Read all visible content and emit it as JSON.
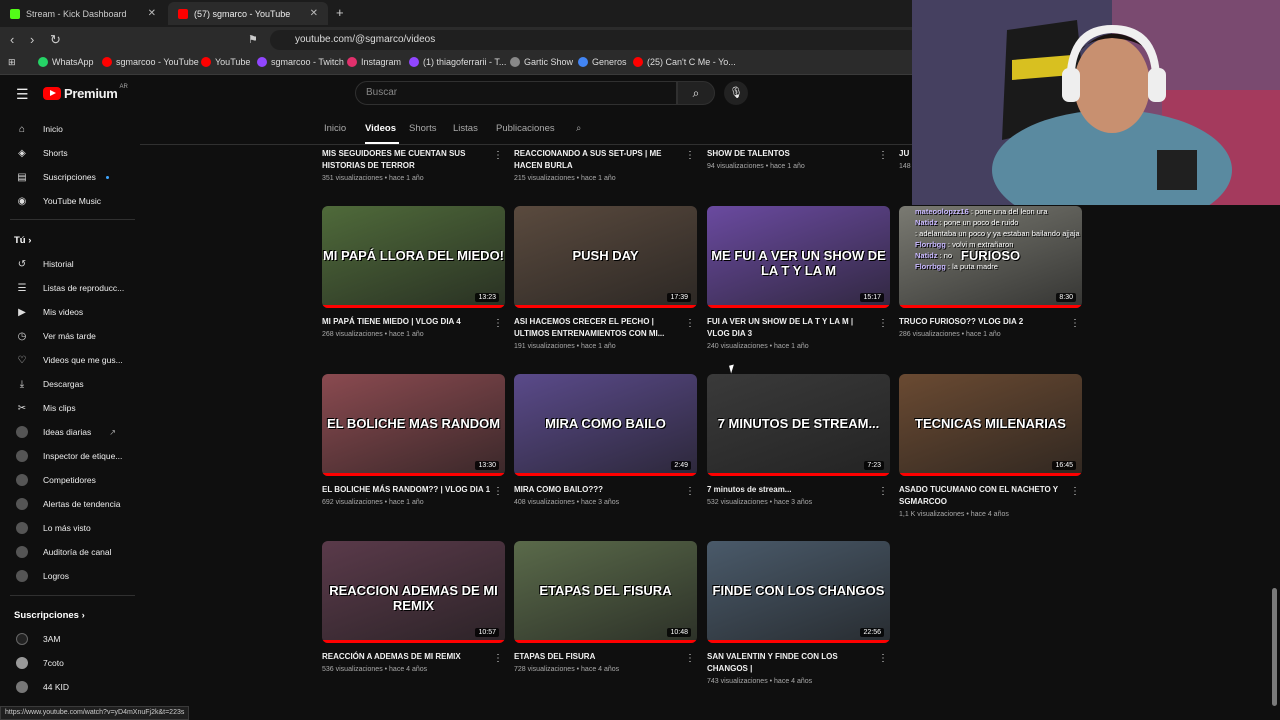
{
  "browser": {
    "tabs": [
      {
        "title": "Stream - Kick Dashboard",
        "fav_color": "#53fc18"
      },
      {
        "title": "(57) sgmarco - YouTube",
        "fav_color": "#ff0000"
      }
    ],
    "new_tab_icon": "+",
    "url": "youtube.com/@sgmarco/videos",
    "bookmarks": [
      {
        "label": "WhatsApp",
        "color": "#25d366"
      },
      {
        "label": "sgmarcoo - YouTube",
        "color": "#ff0000"
      },
      {
        "label": "YouTube",
        "color": "#ff0000"
      },
      {
        "label": "sgmarcoo - Twitch",
        "color": "#9146ff"
      },
      {
        "label": "Instagram",
        "color": "#e1306c"
      },
      {
        "label": "(1) thiagoferrarii - T...",
        "color": "#9146ff"
      },
      {
        "label": "Gartic Show",
        "color": "#888888"
      },
      {
        "label": "Generos",
        "color": "#4285f4"
      },
      {
        "label": "(25) Can't C Me - Yo...",
        "color": "#ff0000"
      }
    ],
    "status_url": "https://www.youtube.com/watch?v=yD4mXnuFj2k&t=223s"
  },
  "masthead": {
    "logo_text": "Premium",
    "country_code": "AR",
    "search_placeholder": "Buscar"
  },
  "sidebar": {
    "main": [
      {
        "label": "Inicio",
        "icon": "home-icon",
        "glyph": "⌂"
      },
      {
        "label": "Shorts",
        "icon": "shorts-icon",
        "glyph": "◈"
      },
      {
        "label": "Suscripciones",
        "icon": "subscriptions-icon",
        "glyph": "▤"
      },
      {
        "label": "YouTube Music",
        "icon": "music-icon",
        "glyph": "◉"
      }
    ],
    "you_title": "Tú",
    "you": [
      {
        "label": "Historial",
        "icon": "history-icon",
        "glyph": "↺"
      },
      {
        "label": "Listas de reproducc...",
        "icon": "playlists-icon",
        "glyph": "☰"
      },
      {
        "label": "Mis videos",
        "icon": "my-videos-icon",
        "glyph": "▶"
      },
      {
        "label": "Ver más tarde",
        "icon": "watch-later-icon",
        "glyph": "◷"
      },
      {
        "label": "Videos que me gus...",
        "icon": "liked-icon",
        "glyph": "👍"
      },
      {
        "label": "Descargas",
        "icon": "downloads-icon",
        "glyph": "⤓"
      },
      {
        "label": "Mis clips",
        "icon": "clips-icon",
        "glyph": "✂"
      },
      {
        "label": "Ideas diarias",
        "icon": "ideas-icon",
        "glyph": "●"
      },
      {
        "label": "Inspector de etique...",
        "icon": "tag-inspector-icon",
        "glyph": "●"
      },
      {
        "label": "Competidores",
        "icon": "competitors-icon",
        "glyph": "●"
      },
      {
        "label": "Alertas de tendencia",
        "icon": "trend-alerts-icon",
        "glyph": "●"
      },
      {
        "label": "Lo más visto",
        "icon": "most-viewed-icon",
        "glyph": "●"
      },
      {
        "label": "Auditoría de canal",
        "icon": "channel-audit-icon",
        "glyph": "●"
      },
      {
        "label": "Logros",
        "icon": "achievements-icon",
        "glyph": "●"
      }
    ],
    "subs_title": "Suscripciones",
    "subs": [
      {
        "label": "3AM"
      },
      {
        "label": "7coto"
      },
      {
        "label": "44 KID"
      }
    ]
  },
  "channel_tabs": [
    "Inicio",
    "Videos",
    "Shorts",
    "Listas",
    "Publicaciones"
  ],
  "top_row": [
    {
      "title": "MIS SEGUIDORES ME CUENTAN SUS HISTORIAS DE TERROR",
      "meta": "351 visualizaciones • hace 1 año"
    },
    {
      "title": "REACCIONANDO A SUS SET-UPS | ME HACEN BURLA",
      "meta": "215 visualizaciones • hace 1 año"
    },
    {
      "title": "SHOW DE TALENTOS",
      "meta": "94 visualizaciones • hace 1 año"
    },
    {
      "title": "JU",
      "meta": "148"
    }
  ],
  "videos": [
    {
      "title": "MI PAPÁ TIENE MIEDO | VLOG DIA 4",
      "meta": "268 visualizaciones • hace 1 año",
      "duration": "13:23",
      "thumb_text": "MI PAPÁ LLORA DEL MIEDO!",
      "bg": "#4f6a3a"
    },
    {
      "title": "ASI HACEMOS CRECER EL PECHO | ULTIMOS ENTRENAMIENTOS CON MI...",
      "meta": "191 visualizaciones • hace 1 año",
      "duration": "17:39",
      "thumb_text": "PUSH DAY",
      "bg": "#5a4a3e"
    },
    {
      "title": "FUI A VER UN SHOW DE LA T Y LA M | VLOG DIA 3",
      "meta": "240 visualizaciones • hace 1 año",
      "duration": "15:17",
      "thumb_text": "ME FUI A VER UN SHOW DE LA T Y LA M",
      "bg": "#6a4aa0"
    },
    {
      "title": "TRUCO FURIOSO?? VLOG DIA 2",
      "meta": "286 visualizaciones • hace 1 año",
      "duration": "8:30",
      "thumb_text": "FURIOSO",
      "bg": "#7a7a72"
    },
    {
      "title": "EL BOLICHE MÁS RANDOM?? | VLOG DIA 1",
      "meta": "692 visualizaciones • hace 1 año",
      "duration": "13:30",
      "thumb_text": "EL BOLICHE MAS RANDOM",
      "bg": "#8a4a50"
    },
    {
      "title": "MIRA COMO BAILO???",
      "meta": "408 visualizaciones • hace 3 años",
      "duration": "2:49",
      "thumb_text": "MIRA COMO BAILO",
      "bg": "#5a4a8a"
    },
    {
      "title": "7 minutos de stream...",
      "meta": "532 visualizaciones • hace 3 años",
      "duration": "7:23",
      "thumb_text": "7 MINUTOS DE STREAM...",
      "bg": "#3a3a3a"
    },
    {
      "title": "ASADO TUCUMANO CON EL NACHETO Y SGMARCOO",
      "meta": "1,1 K visualizaciones • hace 4 años",
      "duration": "16:45",
      "thumb_text": "TECNICAS MILENARIAS",
      "bg": "#6a4a32"
    },
    {
      "title": "REACCIÓN A ADEMAS DE MI REMIX",
      "meta": "536 visualizaciones • hace 4 años",
      "duration": "10:57",
      "thumb_text": "REACCION ADEMAS DE MI REMIX",
      "bg": "#5a3a4a"
    },
    {
      "title": "ETAPAS DEL FISURA",
      "meta": "728 visualizaciones • hace 4 años",
      "duration": "10:48",
      "thumb_text": "ETAPAS DEL FISURA",
      "bg": "#5a6a4a"
    },
    {
      "title": "SAN VALENTIN Y FINDE CON LOS CHANGOS |",
      "meta": "743 visualizaciones • hace 4 años",
      "duration": "22:56",
      "thumb_text": "FINDE CON LOS CHANGOS",
      "bg": "#4a5a6a"
    }
  ],
  "chat": [
    {
      "user": "mateoolopzz16",
      "text": "pone una del leon ura"
    },
    {
      "user": "Natidz",
      "text": "pone un poco de ruido"
    },
    {
      "user": "",
      "text": "adelantaba un poco y ya estaban bailando ajjaja"
    },
    {
      "user": "Florrbgg",
      "text": "volvi m extrañaron"
    },
    {
      "user": "Natidz",
      "text": "no"
    },
    {
      "user": "Florrbgg",
      "text": "la puta madre"
    }
  ]
}
